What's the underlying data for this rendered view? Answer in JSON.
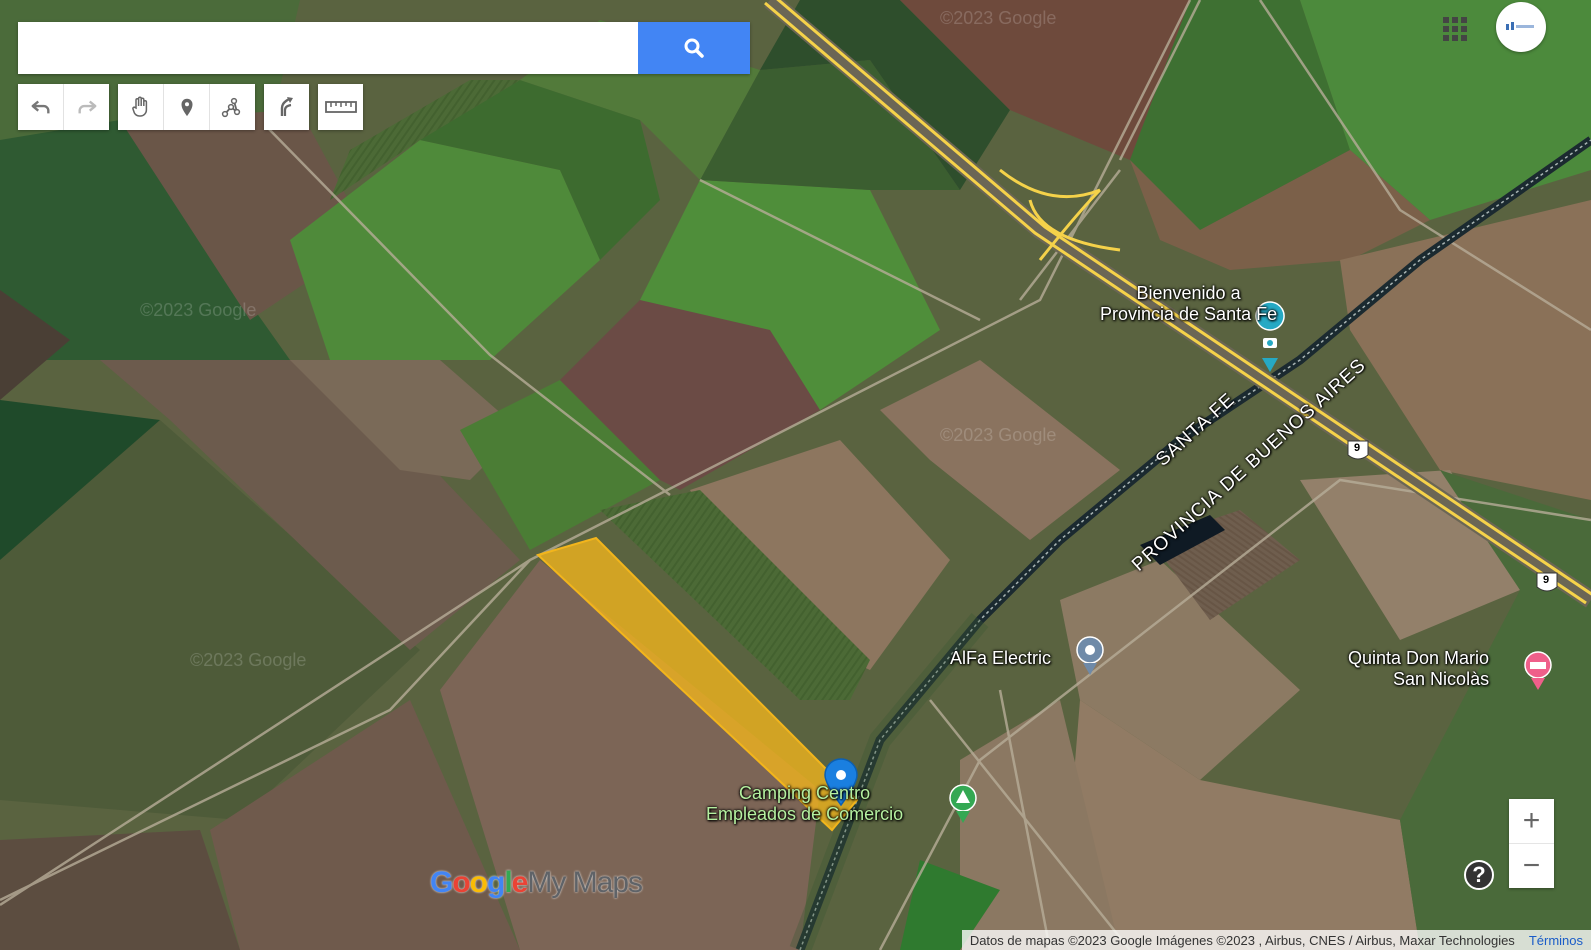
{
  "search": {
    "placeholder": "",
    "value": ""
  },
  "toolbar": {
    "icons": [
      "undo-icon",
      "redo-icon",
      "hand-icon",
      "marker-icon",
      "draw-line-icon",
      "directions-icon",
      "ruler-icon"
    ]
  },
  "map": {
    "labels": {
      "bienvenido_line1": "Bienvenido a",
      "bienvenido_line2": "Provincia de Santa Fe",
      "santa_fe": "SANTA FE",
      "provincia_bsas": "PROVINCIA DE BUENOS AIRES",
      "alfa": "AlFa Electric",
      "quinta_line1": "Quinta Don Mario",
      "quinta_line2": "San Nicolàs",
      "camping_line1": "Camping Centro",
      "camping_line2": "Empleados de Comercio",
      "route_shield_1": "9",
      "route_shield_2": "9"
    },
    "watermark": "©2023 Google",
    "colors": {
      "highlight": "#f2b51c",
      "marker": "#1a7fe0",
      "road": "#f5d24a"
    }
  },
  "logo": {
    "google": [
      "G",
      "o",
      "o",
      "g",
      "l",
      "e"
    ],
    "google_colors": [
      "#4285f4",
      "#ea4335",
      "#fbbc05",
      "#4285f4",
      "#34a853",
      "#ea4335"
    ],
    "my_maps": "My Maps"
  },
  "attribution": {
    "text": "Datos de mapas ©2023 Google Imágenes ©2023 , Airbus, CNES / Airbus, Maxar Technologies",
    "terms": "Términos"
  },
  "zoom": {
    "in": "+",
    "out": "−"
  },
  "help_label": "?"
}
